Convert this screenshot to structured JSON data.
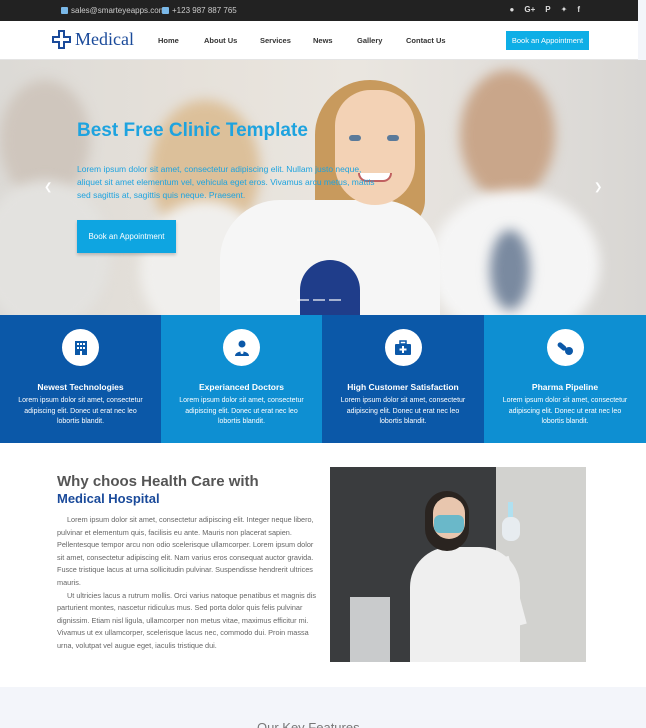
{
  "topbar": {
    "email": "sales@smarteyeapps.com",
    "phone": "+123 987 887 765",
    "social": [
      "github-icon",
      "google-plus-icon",
      "pinterest-icon",
      "twitter-icon",
      "facebook-icon"
    ]
  },
  "header": {
    "logo_text": "Medical",
    "nav": [
      "Home",
      "About Us",
      "Services",
      "News",
      "Gallery",
      "Contact Us"
    ],
    "cta": "Book an Appointment"
  },
  "hero": {
    "title": "Best Free Clinic Template",
    "text": "Lorem ipsum dolor sit amet, consectetur adipiscing elit. Nullam justo neque, aliquet sit amet elementum vel, vehicula eget eros. Vivamus arcu metus, mattis sed sagittis at, sagittis quis neque. Praesent.",
    "button": "Book an Appointment"
  },
  "features": [
    {
      "title": "Newest Technologies",
      "text": "Lorem ipsum dolor sit amet, consectetur adipiscing elit. Donec ut erat nec leo lobortis blandit.",
      "icon": "building-icon",
      "color": "#0b58a8"
    },
    {
      "title": "Experianced Doctors",
      "text": "Lorem ipsum dolor sit amet, consectetur adipiscing elit. Donec ut erat nec leo lobortis blandit.",
      "icon": "doctor-icon",
      "color": "#0e8fd2"
    },
    {
      "title": "High Customer Satisfaction",
      "text": "Lorem ipsum dolor sit amet, consectetur adipiscing elit. Donec ut erat nec leo lobortis blandit.",
      "icon": "medkit-icon",
      "color": "#0b58a8"
    },
    {
      "title": "Pharma Pipeline",
      "text": "Lorem ipsum dolor sit amet, consectetur adipiscing elit. Donec ut erat nec leo lobortis blandit.",
      "icon": "pills-icon",
      "color": "#0e8fd2"
    }
  ],
  "why": {
    "title": "Why choos Health Care with",
    "subtitle": "Medical Hospital",
    "para1": "Lorem ipsum dolor sit amet, consectetur adipiscing elit. Integer neque libero, pulvinar et elementum quis, facilisis eu ante. Mauris non placerat sapien. Pellentesque tempor arcu non odio scelerisque ullamcorper. Lorem ipsum dolor sit amet, consectetur adipiscing elit. Nam varius eros consequat auctor gravida. Fusce tristique lacus at urna sollicitudin pulvinar. Suspendisse hendrerit ultrices mauris.",
    "para2": "Ut ultricies lacus a rutrum mollis. Orci varius natoque penatibus et magnis dis parturient montes, nascetur ridiculus mus. Sed porta dolor quis felis pulvinar dignissim. Etiam nisl ligula, ullamcorper non metus vitae, maximus efficitur mi. Vivamus ut ex ullamcorper, scelerisque lacus nec, commodo dui. Proin massa urna, volutpat vel augue eget, iaculis tristique dui."
  },
  "next_section": {
    "title": "Our Key Features"
  },
  "colors": {
    "accent": "#0eaee6",
    "brand": "#1a4a9a",
    "dark_blue": "#0b58a8",
    "light_blue": "#0e8fd2"
  }
}
